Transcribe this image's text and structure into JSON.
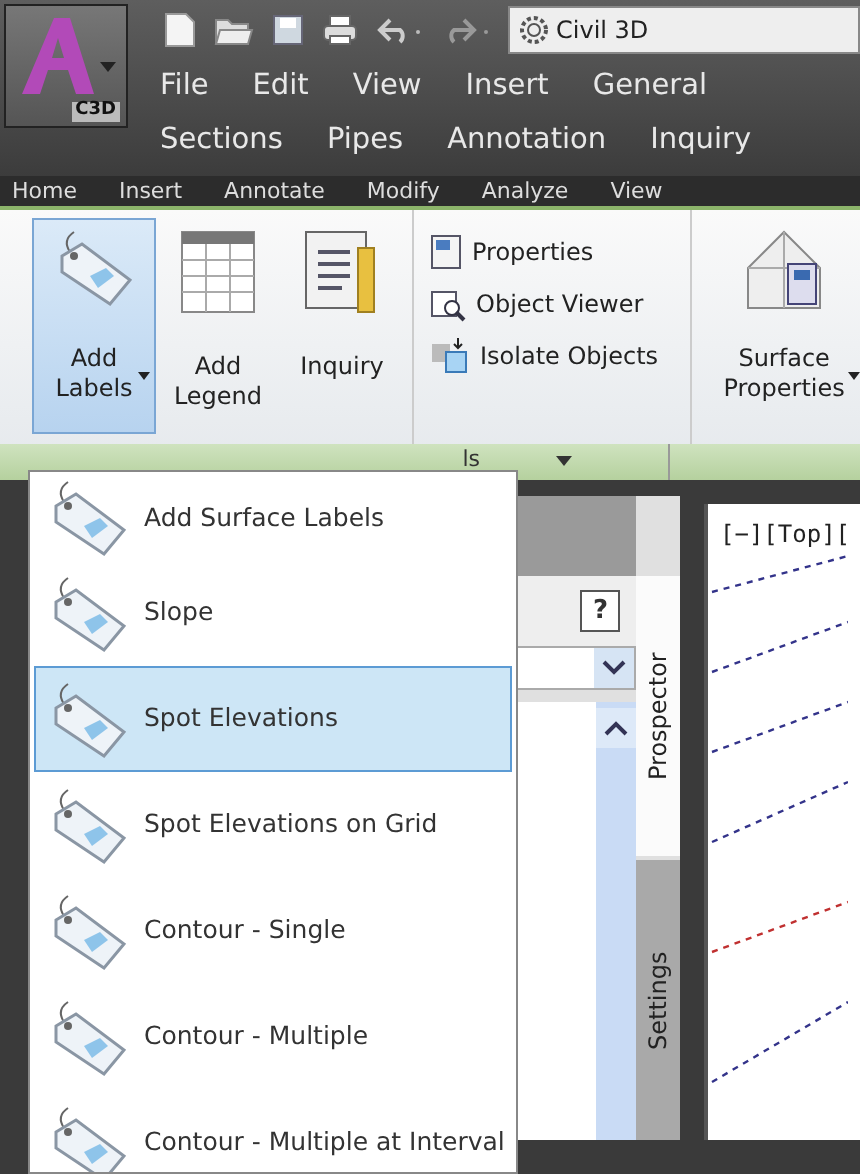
{
  "app_button": {
    "label": "C3D"
  },
  "quick_access": {
    "workspace": "Civil 3D"
  },
  "menu_rows": [
    [
      "File",
      "Edit",
      "View",
      "Insert",
      "General"
    ],
    [
      "Sections",
      "Pipes",
      "Annotation",
      "Inquiry"
    ]
  ],
  "ribbon_tabs": [
    {
      "label": "Home",
      "selected": false
    },
    {
      "label": "Insert",
      "selected": false
    },
    {
      "label": "Annotate",
      "selected": false
    },
    {
      "label": "Modify",
      "selected": false
    },
    {
      "label": "Analyze",
      "selected": false
    },
    {
      "label": "View",
      "selected": false
    }
  ],
  "ribbon": {
    "large_buttons": [
      {
        "kind": "tag",
        "label": "Add Labels",
        "selected": true,
        "dropdown": true
      },
      {
        "kind": "table",
        "label": "Add Legend",
        "selected": false,
        "dropdown": false
      },
      {
        "kind": "inquiry",
        "label": "Inquiry",
        "selected": false,
        "dropdown": false
      }
    ],
    "small_buttons": [
      {
        "kind": "properties",
        "label": "Properties"
      },
      {
        "kind": "viewer",
        "label": "Object Viewer"
      },
      {
        "kind": "isolate",
        "label": "Isolate Objects"
      }
    ],
    "panel_title": "ls",
    "surface_button": {
      "label": "Surface Properties",
      "dropdown": true
    }
  },
  "toolspace": {
    "help": "?",
    "tabs": [
      {
        "label": "Prospector",
        "selected": true
      },
      {
        "label": "Settings",
        "selected": false
      }
    ]
  },
  "viewport": {
    "label": "[−][Top]["
  },
  "dropdown": {
    "items": [
      {
        "label": "Add Surface Labels",
        "selected": false
      },
      {
        "label": "Slope",
        "selected": false
      },
      {
        "label": "Spot Elevations",
        "selected": true
      },
      {
        "label": "Spot Elevations on Grid",
        "selected": false
      },
      {
        "label": "Contour - Single",
        "selected": false
      },
      {
        "label": "Contour - Multiple",
        "selected": false
      },
      {
        "label": "Contour - Multiple at Interval",
        "selected": false
      }
    ]
  }
}
